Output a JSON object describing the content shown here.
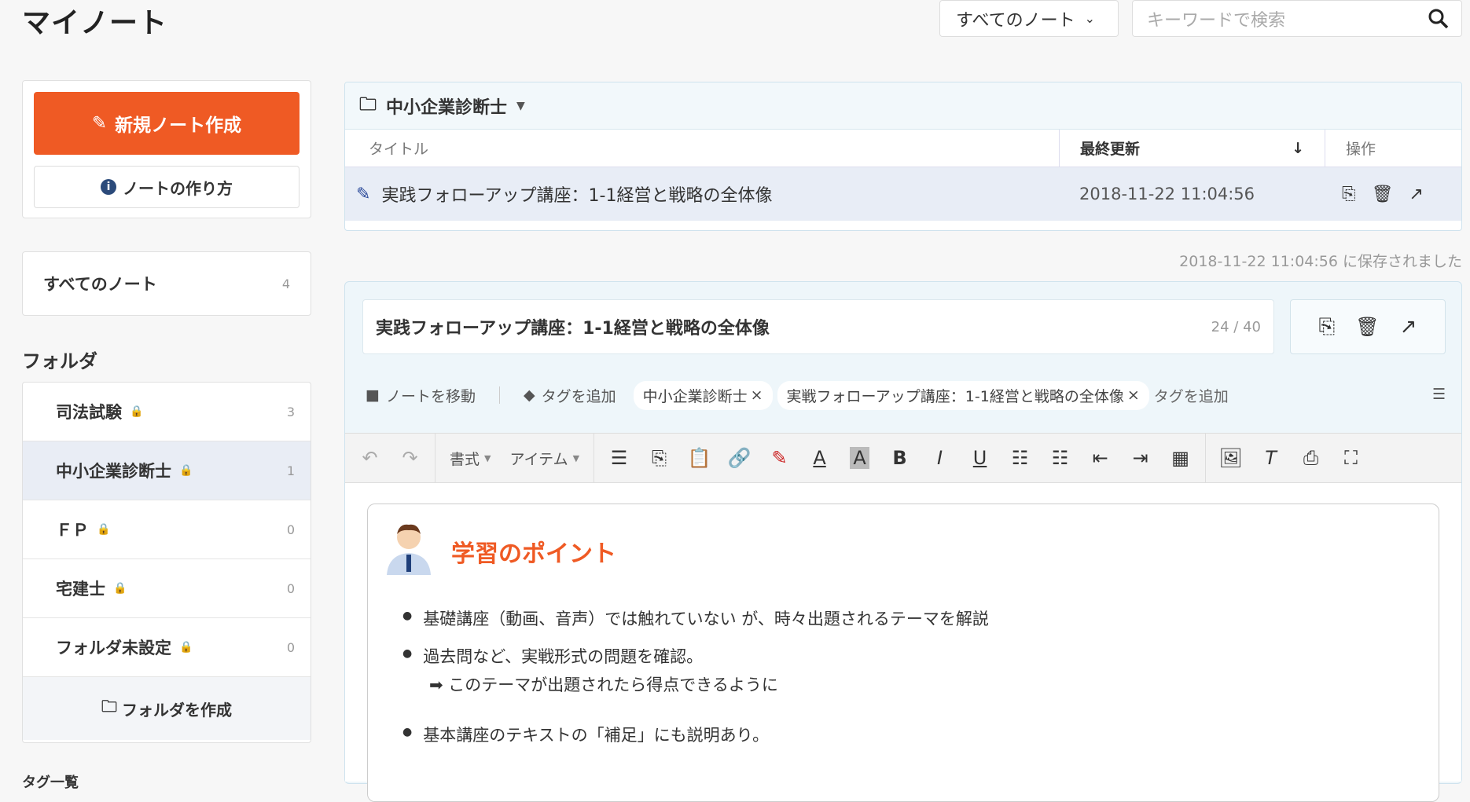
{
  "header": {
    "title": "マイノート",
    "filter_value": "すべてのノート",
    "search_placeholder": "キーワードで検索"
  },
  "sidebar": {
    "new_note": "新規ノート作成",
    "how_to": "ノートの作り方",
    "all_notes": {
      "label": "すべてのノート",
      "count": "4"
    },
    "folders_label": "フォルダ",
    "folders": [
      {
        "name": "司法試験",
        "count": "3"
      },
      {
        "name": "中小企業診断士",
        "count": "1"
      },
      {
        "name": "ＦＰ",
        "count": "0"
      },
      {
        "name": "宅建士",
        "count": "0"
      },
      {
        "name": "フォルダ未設定",
        "count": "0"
      }
    ],
    "create_folder": "フォルダを作成",
    "cut_label": "タグ一覧"
  },
  "list": {
    "folder": "中小企業診断士",
    "col_title": "タイトル",
    "col_updated": "最終更新",
    "col_actions": "操作",
    "row": {
      "title": "実践フォローアップ講座：1-1経営と戦略の全体像",
      "updated": "2018-11-22 11:04:56"
    }
  },
  "saved_msg": "2018-11-22 11:04:56 に保存されました",
  "editor": {
    "title": "実践フォローアップ講座：1-1経営と戦略の全体像",
    "char_count": "24 / 40",
    "move_note": "ノートを移動",
    "add_tag": "タグを追加",
    "tags": [
      "中小企業診断士",
      "実戦フォローアップ講座：1-1経営と戦略の全体像"
    ],
    "tag_input_placeholder": "タグを追加",
    "format_menu": "書式",
    "item_menu": "アイテム",
    "content": {
      "heading": "学習のポイント",
      "bullets": [
        "基礎講座（動画、音声）では触れていない が、時々出題されるテーマを解説",
        "過去問など、実戦形式の問題を確認。",
        "基本講座のテキストの「補足」にも説明あり。"
      ],
      "sub": "➡ このテーマが出題されたら得点できるように"
    }
  },
  "colors": {
    "accent": "#ef5a24",
    "active_row": "#e8edf6"
  }
}
